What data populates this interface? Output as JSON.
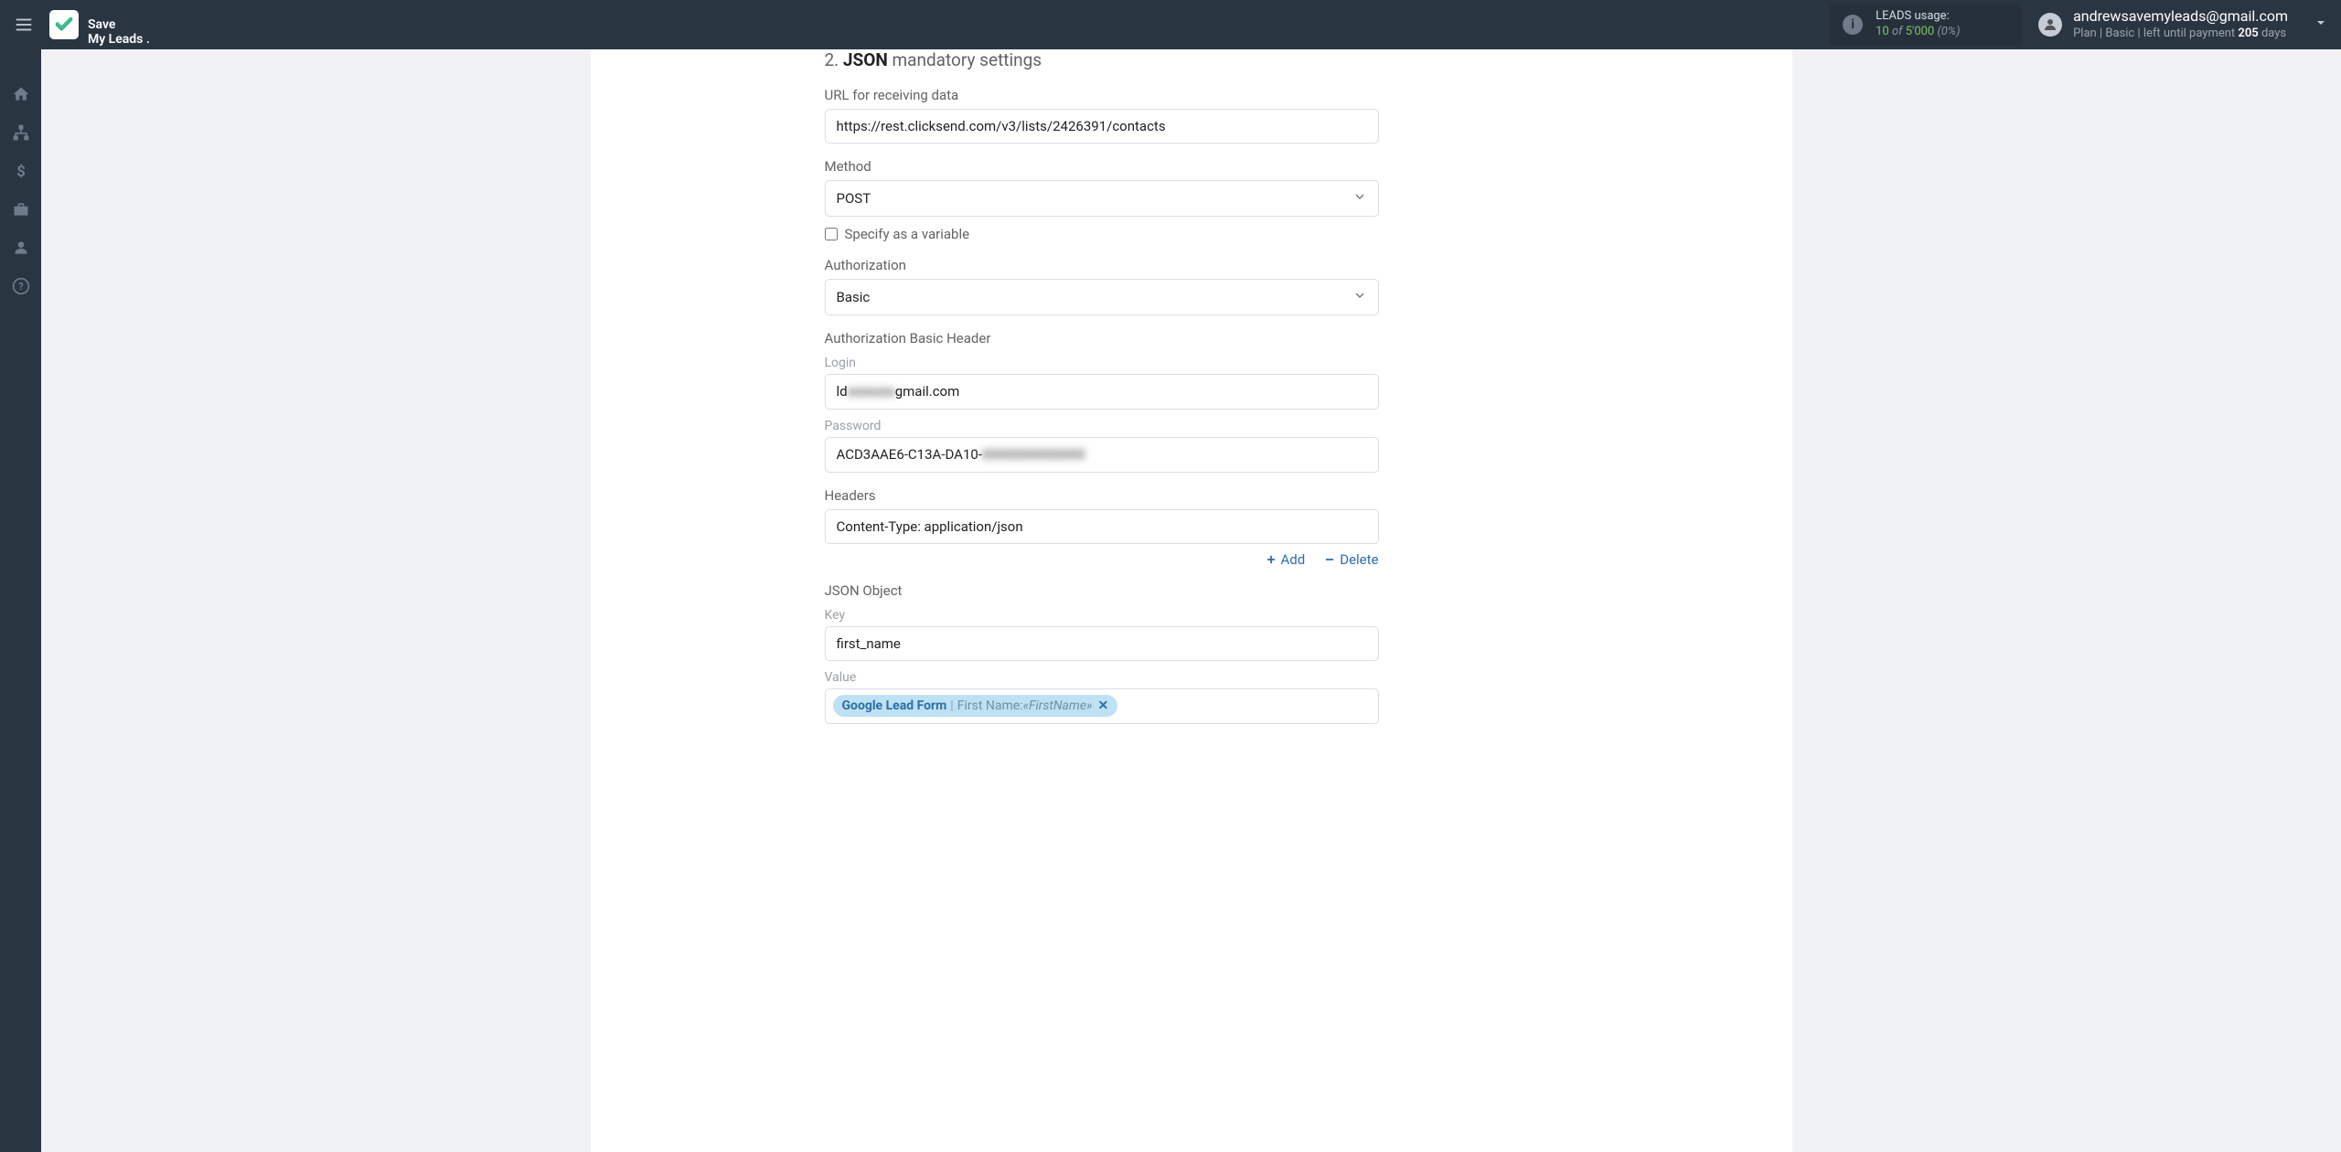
{
  "header": {
    "logo_line1": "Save",
    "logo_line2": "My Leads .",
    "usage_label": "LEADS usage:",
    "usage_current": "10",
    "usage_of": "of",
    "usage_total": "5'000",
    "usage_pct": "(0%)",
    "account_email": "andrewsavemyleads@gmail.com",
    "account_plan_label": "Plan |",
    "account_plan_name": "Basic",
    "account_until_prefix": "| left until payment",
    "account_days": "205",
    "account_days_suffix": "days"
  },
  "form": {
    "section_num": "2.",
    "section_bold": "JSON",
    "section_rest": "mandatory settings",
    "url_label": "URL for receiving data",
    "url_value": "https://rest.clicksend.com/v3/lists/2426391/contacts",
    "method_label": "Method",
    "method_value": "POST",
    "specify_label": "Specify as a variable",
    "auth_label": "Authorization",
    "auth_value": "Basic",
    "basic_header_label": "Authorization Basic Header",
    "login_label": "Login",
    "login_prefix": "ld",
    "login_blur": "xxxxxxx",
    "login_suffix": "gmail.com",
    "password_label": "Password",
    "password_prefix": "ACD3AAE6-C13A-DA10-",
    "password_blur": "XXXXXXXXXXXX",
    "headers_label": "Headers",
    "headers_value": "Content-Type: application/json",
    "add_label": "Add",
    "delete_label": "Delete",
    "json_object_label": "JSON Object",
    "key_label": "Key",
    "key_value": "first_name",
    "value_label": "Value",
    "chip_source": "Google Lead Form",
    "chip_field": "First Name:",
    "chip_var": "«FirstName»"
  }
}
